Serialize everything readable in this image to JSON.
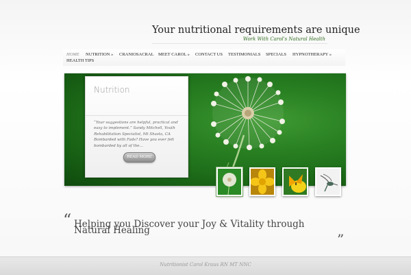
{
  "header": {
    "title": "Your nutritional requirements are unique",
    "tagline": "Work With Carol's Natural Health"
  },
  "nav": {
    "items": [
      {
        "label": "Home"
      },
      {
        "label": "Nutrition »"
      },
      {
        "label": "Craniosacral"
      },
      {
        "label": "Meet Carol »"
      },
      {
        "label": "Contact Us"
      },
      {
        "label": "Testimonials"
      },
      {
        "label": "Specials"
      },
      {
        "label": "Hypnotherapy »"
      },
      {
        "label": "Health Tips"
      }
    ]
  },
  "slider": {
    "caption_title": "Nutrition",
    "caption_text": "“Your suggestions are helpful, practical and easy to implement.” Sandy Mitchell, Youth Rehabilitation Specialist, Mt Shasta, CA Bombarded with Fads? Have you ever felt bombarded by all of the…",
    "read_more_label": "READ MORE",
    "thumbnails": [
      {
        "icon": "dandelion-icon"
      },
      {
        "icon": "yellow-flower-icon"
      },
      {
        "icon": "butterfly-icon"
      },
      {
        "icon": "hummingbird-icon"
      }
    ]
  },
  "quote": {
    "open_mark": "“",
    "text": "Helping you Discover your Joy & Vitality through Natural Healing",
    "close_mark": "”"
  },
  "footer": {
    "text": "Nutritionist Carol Kraus RN MT NNC"
  },
  "colors": {
    "accent_green": "#2f6b1f",
    "slider_green": "#2a8223"
  }
}
